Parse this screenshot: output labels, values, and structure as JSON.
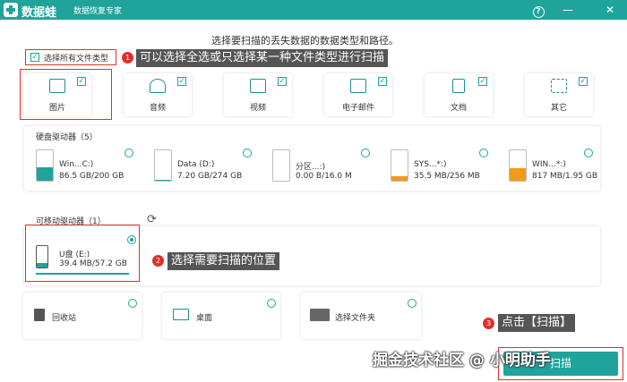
{
  "app": {
    "name": "数据蛙",
    "subtitle": "数据恢复专家"
  },
  "window_controls": {
    "help": "?",
    "minimize": "—",
    "close": "✕"
  },
  "heading": "选择要扫描的丢失数据的数据类型和路径。",
  "select_all": {
    "label": "选择所有文件类型",
    "checked": true
  },
  "file_types": [
    {
      "label": "图片",
      "icon": "image-icon",
      "checked": true
    },
    {
      "label": "音频",
      "icon": "music-icon",
      "checked": true
    },
    {
      "label": "视频",
      "icon": "video-icon",
      "checked": true
    },
    {
      "label": "电子邮件",
      "icon": "mail-icon",
      "checked": true
    },
    {
      "label": "文档",
      "icon": "document-icon",
      "checked": true
    },
    {
      "label": "其它",
      "icon": "other-icon",
      "checked": true
    }
  ],
  "hard_drives": {
    "title": "硬盘驱动器（5）",
    "items": [
      {
        "name": "Win...C:)",
        "size": "86.5 GB/200 GB",
        "fill_pct": 43,
        "color": "#1fa39b"
      },
      {
        "name": "Data (D:)",
        "size": "7.20 GB/274 GB",
        "fill_pct": 3,
        "color": "#1fa39b"
      },
      {
        "name": "分区...:)",
        "size": "0.00  B/16.0 M",
        "fill_pct": 0,
        "color": "#1fa39b"
      },
      {
        "name": "SYS...*:)",
        "size": "35.5 MB/256 MB",
        "fill_pct": 14,
        "color": "#f29a1a"
      },
      {
        "name": "WIN...*:)",
        "size": "817 MB/1.95 GB",
        "fill_pct": 42,
        "color": "#f29a1a"
      }
    ]
  },
  "removable": {
    "title": "可移动驱动器（1）",
    "items": [
      {
        "name": "U盘 (E:)",
        "size": "39.4 MB/57.2 GB",
        "selected": true
      }
    ]
  },
  "locations": [
    {
      "label": "回收站",
      "icon": "recycle-bin-icon"
    },
    {
      "label": "桌面",
      "icon": "desktop-icon"
    },
    {
      "label": "选择文件夹",
      "icon": "folder-icon"
    }
  ],
  "annotations": [
    {
      "num": "1",
      "text": "可以选择全选或只选择某一种文件类型进行扫描"
    },
    {
      "num": "2",
      "text": "选择需要扫描的位置"
    },
    {
      "num": "3",
      "text": "点击【扫描】"
    }
  ],
  "scan_button": "扫描",
  "watermark": "掘金技术社区 @ 小明助手",
  "colors": {
    "accent": "#1fa39b",
    "highlight": "#e0302c",
    "warning": "#f29a1a"
  }
}
